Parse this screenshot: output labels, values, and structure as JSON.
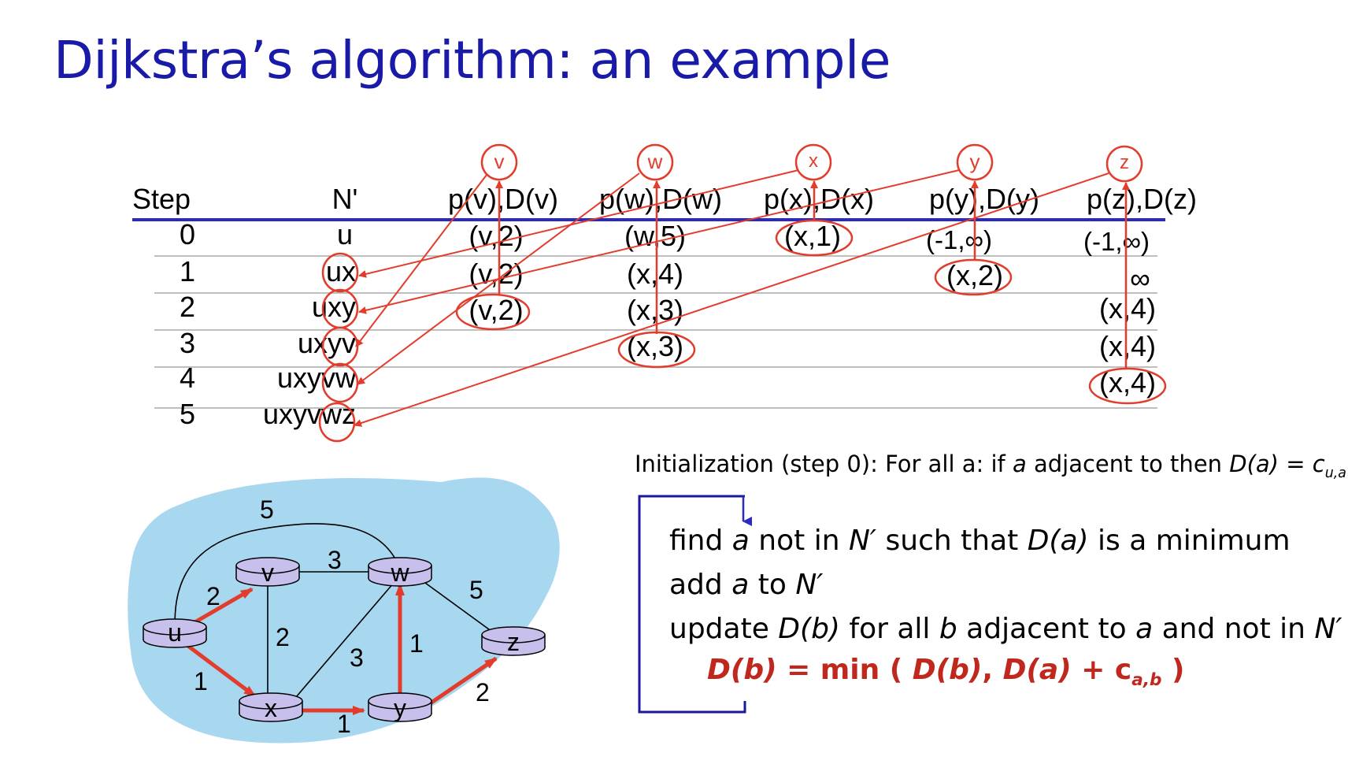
{
  "title": "Dijkstra’s algorithm: an example",
  "table": {
    "headers": [
      "Step",
      "N'",
      "p(v),D(v)",
      "p(w),D(w)",
      "p(x),D(x)",
      "p(y),D(y)",
      "p(z),D(z)"
    ],
    "circled_nodes": [
      "v",
      "w",
      "x",
      "y",
      "z"
    ],
    "steps": [
      "0",
      "1",
      "2",
      "3",
      "4",
      "5"
    ],
    "nprime": [
      "u",
      "ux",
      "uxy",
      "uxyv",
      "uxyvw",
      "uxyvwz"
    ],
    "cells": {
      "v": [
        "(v,2)",
        "(v,2)",
        "(v,2)"
      ],
      "w": [
        "(w,5)",
        "(x,4)",
        "(x,3)",
        "(x,3)"
      ],
      "x": [
        "(x,1)"
      ],
      "y": [
        "(-1,∞)",
        "(x,2)"
      ],
      "z": [
        "(-1,∞)",
        "∞",
        "(x,4)",
        "(x,4)",
        "(x,4)"
      ]
    }
  },
  "graph": {
    "nodes": [
      "u",
      "v",
      "w",
      "x",
      "y",
      "z"
    ],
    "edge_weights": [
      "5",
      "2",
      "3",
      "1",
      "2",
      "3",
      "1",
      "5",
      "1",
      "2"
    ],
    "colors": {
      "cloud": "#a8d8f0",
      "router": "#c8c0ec",
      "highlight": "#e23c2c"
    }
  },
  "algorithm": {
    "init": {
      "prefix": "Initialization (step 0): For all a: if ",
      "a": "a",
      "mid": " adjacent to then ",
      "da": "D(a)",
      "eq": " = c",
      "sub": "u,a"
    },
    "line1": {
      "t1": "find ",
      "a": "a",
      "t2": " not in ",
      "n": "N′",
      "t3": " such that ",
      "da": "D(a)",
      "t4": " is a minimum"
    },
    "line2": {
      "t1": "add ",
      "a": "a",
      "t2": " to ",
      "n": "N′"
    },
    "line3": {
      "t1": "update ",
      "db": "D(b)",
      "t2": " for all ",
      "b": "b",
      "t3": " adjacent to ",
      "a": "a",
      "t4": " and not in ",
      "n": "N′",
      "t5": " :"
    },
    "formula": {
      "lhs": "D(b)",
      "t1": " = min ( ",
      "db": "D(b)",
      "t2": ", ",
      "da": "D(a)",
      "t3": " + c",
      "sub": "a,b",
      "t4": " )"
    }
  },
  "colors": {
    "title": "#1a1aa8",
    "accent": "#e23c2c",
    "rule": "#2a2ac0",
    "loop": "#1a1a9a"
  }
}
